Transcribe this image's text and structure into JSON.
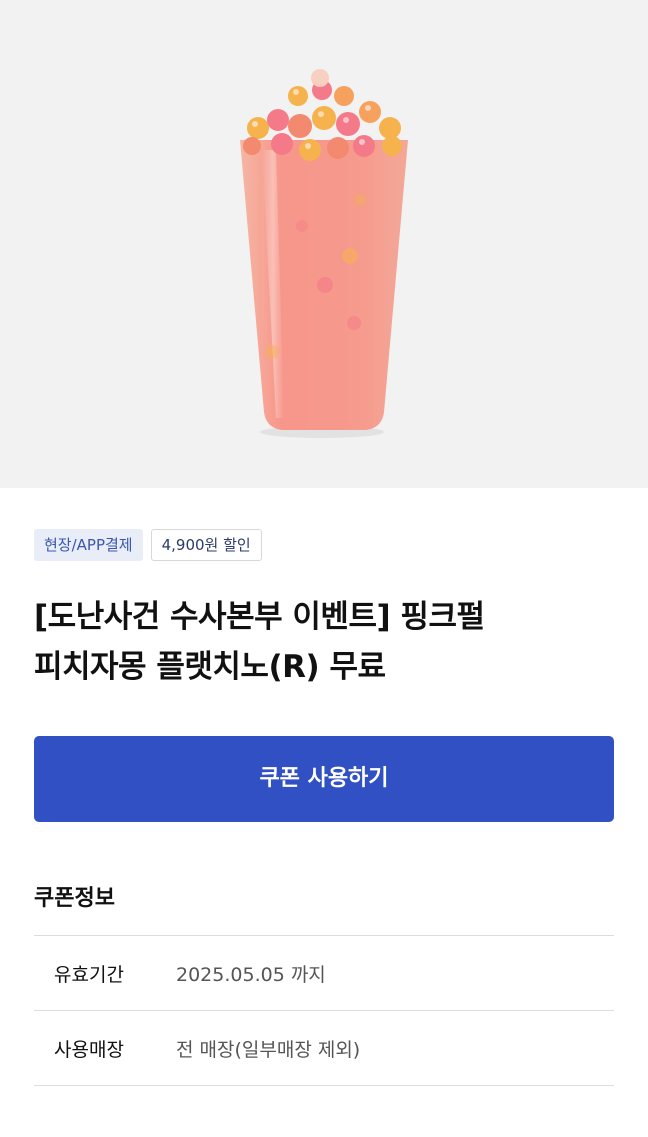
{
  "product_image": {
    "subject": "pink pearl peach jamong frappuccino cup",
    "colors": {
      "background": "#f2f2f2",
      "drink": "#f6988b",
      "pearl_pink": "#f47a8a",
      "pearl_yellow": "#f6b24d"
    }
  },
  "badges": {
    "payment": "현장/APP결제",
    "discount": "4,900원 할인"
  },
  "product": {
    "title_line1": "[도난사건 수사본부 이벤트] 핑크펄",
    "title_line2": "피치자몽 플랫치노(R) 무료"
  },
  "actions": {
    "use_coupon": "쿠폰 사용하기"
  },
  "coupon_info": {
    "heading": "쿠폰정보",
    "rows": [
      {
        "label": "유효기간",
        "value": "2025.05.05 까지"
      },
      {
        "label": "사용매장",
        "value": "전 매장(일부매장 제외)"
      }
    ]
  },
  "colors": {
    "accent": "#3050c3",
    "badge_blue_bg": "#e8edf8",
    "badge_blue_text": "#3a57b0"
  }
}
